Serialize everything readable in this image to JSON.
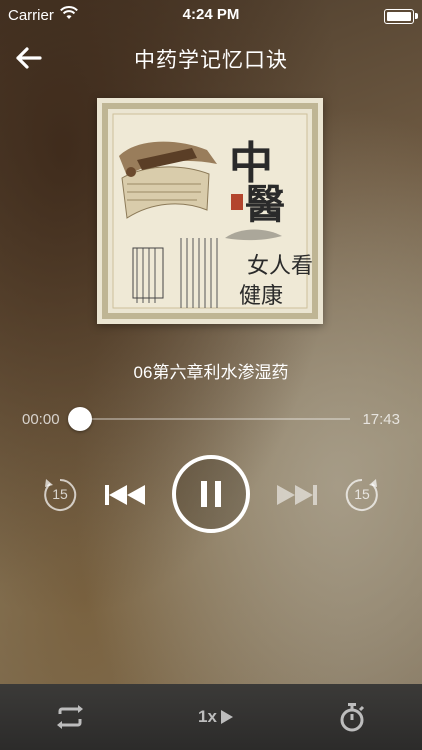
{
  "status_bar": {
    "carrier": "Carrier",
    "time": "4:24 PM"
  },
  "nav": {
    "title": "中药学记忆口诀",
    "back_icon": "arrow-left-icon"
  },
  "player": {
    "track_title": "06第六章利水渗湿药",
    "elapsed": "00:00",
    "duration": "17:43",
    "progress_fraction": 0.0,
    "rewind_seconds": "15",
    "forward_seconds": "15",
    "state": "playing"
  },
  "bottom_bar": {
    "speed_label": "1x",
    "repeat_icon": "repeat-icon",
    "timer_icon": "stopwatch-icon"
  },
  "colors": {
    "bottom_bar_bg": "#2f2e2d",
    "icon_gray": "#bdbdbd"
  }
}
